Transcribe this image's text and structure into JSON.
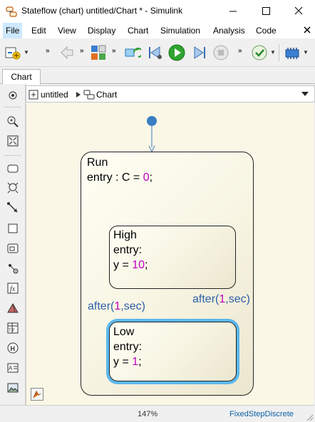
{
  "window": {
    "title": "Stateflow (chart) untitled/Chart * - Simulink"
  },
  "menu": {
    "items": [
      "File",
      "Edit",
      "View",
      "Display",
      "Chart",
      "Simulation",
      "Analysis",
      "Code"
    ]
  },
  "tabs": [
    "Chart"
  ],
  "breadcrumb": {
    "root": "untitled",
    "current": "Chart"
  },
  "chart": {
    "run": {
      "name": "Run",
      "entry_prefix": "entry : C = ",
      "entry_value": "0",
      "entry_suffix": ";"
    },
    "high": {
      "name": "High",
      "entry": "entry:",
      "action_prefix": "y = ",
      "action_value": "10",
      "action_suffix": ";"
    },
    "low": {
      "name": "Low",
      "entry": "entry:",
      "action_prefix": "y = ",
      "action_value": "1",
      "action_suffix": ";"
    },
    "transition_high_to_low": {
      "prefix": "after(",
      "value": "1",
      "suffix": ",sec)"
    },
    "transition_low_to_high": {
      "prefix": "after(",
      "value": "1",
      "suffix": ",sec)"
    }
  },
  "status": {
    "zoom": "147%",
    "solver": "FixedStepDiscrete"
  },
  "icons": {
    "app": "stateflow-app-icon",
    "toolbar": [
      "model-config-icon",
      "back-icon",
      "library-browser-icon",
      "update-diagram-icon",
      "step-back-icon",
      "run-icon",
      "step-forward-icon",
      "stop-icon",
      "check-icon",
      "hardware-icon"
    ],
    "palette": [
      "zoom-fit-icon",
      "zoom-in-icon",
      "fit-to-view-icon",
      "state-tool-icon",
      "default-transition-icon",
      "junction-tool-icon",
      "transition-tool-icon",
      "box-tool-icon",
      "simulink-function-icon",
      "history-junction-icon",
      "matlab-function-icon",
      "simulink-state-icon",
      "truth-table-icon",
      "history-icon",
      "annotation-icon",
      "image-icon"
    ]
  },
  "colors": {
    "transition": "#2c5fa8",
    "numeric_literal": "#c000c0",
    "selection_highlight": "#5bb8ee",
    "canvas": "#fbf7e6"
  }
}
